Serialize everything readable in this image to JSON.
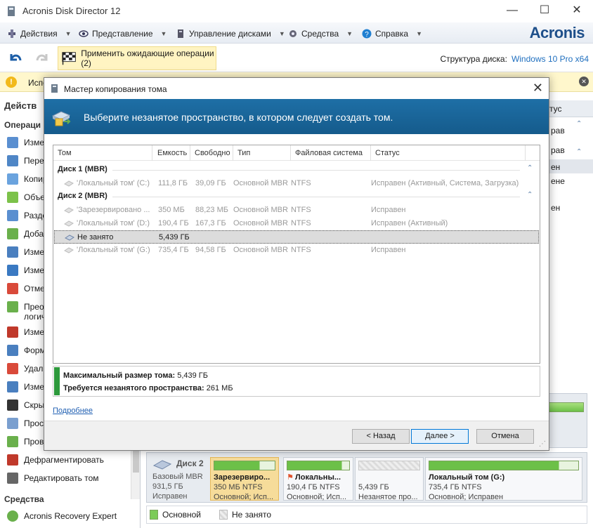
{
  "window": {
    "title": "Acronis Disk Director 12",
    "minimize": "—",
    "maximize": "☐",
    "close": "✕"
  },
  "menu": {
    "items": [
      {
        "label": "Действия"
      },
      {
        "label": "Представление"
      },
      {
        "label": "Управление дисками"
      },
      {
        "label": "Средства"
      },
      {
        "label": "Справка"
      }
    ],
    "brand": "Acronis"
  },
  "toolbar": {
    "apply_label": "Применить ожидающие операции (2)",
    "disk_structure_label": "Структура диска:",
    "disk_structure_value": "Windows 10 Pro x64"
  },
  "infobar": {
    "text": "Испо"
  },
  "sidebar": {
    "header": "Действ",
    "operations_header": "Операци",
    "operations": [
      {
        "label": "Измен",
        "color": "#5a8fd0"
      },
      {
        "label": "Перем",
        "color": "#4f86c6"
      },
      {
        "label": "Копир",
        "color": "#6aa3de"
      },
      {
        "label": "Объед",
        "color": "#7cc24a"
      },
      {
        "label": "Разде",
        "color": "#5a8fd0"
      },
      {
        "label": "Добав",
        "color": "#6ab04c"
      },
      {
        "label": "Измен",
        "color": "#4a7fbf"
      },
      {
        "label": "Измен",
        "color": "#3a79c2"
      },
      {
        "label": "Отме",
        "color": "#d94a3a"
      },
      {
        "label": "Преоб",
        "color": "#6ab04c"
      },
      {
        "label": "логич",
        "color": "#ffffff"
      },
      {
        "label": "Измен",
        "color": "#c0392b"
      },
      {
        "label": "Форм",
        "color": "#4a7fbf"
      },
      {
        "label": "Удал",
        "color": "#d94a3a"
      },
      {
        "label": "Измен",
        "color": "#4a7fbf"
      },
      {
        "label": "Скры",
        "color": "#333333"
      },
      {
        "label": "Прос",
        "color": "#7a9fcf"
      },
      {
        "label": "Пров",
        "color": "#6ab04c"
      },
      {
        "label": "Дефрагментировать",
        "color": "#c0392b"
      },
      {
        "label": "Редактировать том",
        "color": "#666666"
      }
    ],
    "tools_header": "Средства",
    "tools": [
      {
        "label": "Acronis Recovery Expert",
        "color": "#6ab04c"
      }
    ]
  },
  "right_panel": {
    "header": "тус",
    "rows": [
      "рав",
      "рав",
      "ен",
      "ене",
      "ен"
    ]
  },
  "diskmap": {
    "disk": {
      "name": "Диск 2",
      "type": "Базовый MBR",
      "size": "931,5 ГБ",
      "status": "Исправен"
    },
    "partitions": [
      {
        "name": "Зарезервиро...",
        "info": "350 МБ NTFS",
        "status": "Основной; Исп...",
        "fill": 0.75,
        "free": false,
        "selected": true
      },
      {
        "name": "Локальны...",
        "info": "190,4 ГБ NTFS",
        "status": "Основной; Исп...",
        "fill": 0.88,
        "free": false,
        "selected": false
      },
      {
        "name": "",
        "info": "5,439 ГБ",
        "status": "Незанятое про...",
        "fill": 0,
        "free": true,
        "selected": false
      },
      {
        "name": "Локальный том (G:)",
        "info": "735,4 ГБ NTFS",
        "status": "Основной; Исправен",
        "fill": 0.87,
        "free": false,
        "selected": false
      }
    ],
    "legend": {
      "primary": "Основной",
      "free": "Не занято"
    }
  },
  "dialog": {
    "title": "Мастер копирования тома",
    "header_text": "Выберите незанятое пространство, в котором следует создать том.",
    "columns": [
      "Том",
      "Емкость",
      "Свободно",
      "Тип",
      "Файловая система",
      "Статус"
    ],
    "groups": [
      {
        "name": "Диск 1 (MBR)",
        "rows": [
          {
            "volume": "'Локальный том' (C:)",
            "capacity": "111,8 ГБ",
            "free": "39,09 ГБ",
            "type": "Основной MBR",
            "fs": "NTFS",
            "status": "Исправен (Активный, Система, Загрузка)",
            "selected": false
          }
        ]
      },
      {
        "name": "Диск 2 (MBR)",
        "rows": [
          {
            "volume": "'Зарезервировано ...",
            "capacity": "350 МБ",
            "free": "88,23 МБ",
            "type": "Основной MBR",
            "fs": "NTFS",
            "status": "Исправен",
            "selected": false
          },
          {
            "volume": "'Локальный том' (D:)",
            "capacity": "190,4 ГБ",
            "free": "167,3 ГБ",
            "type": "Основной MBR",
            "fs": "NTFS",
            "status": "Исправен (Активный)",
            "selected": false
          },
          {
            "volume": "Не занято",
            "capacity": "5,439 ГБ",
            "free": "",
            "type": "",
            "fs": "",
            "status": "",
            "selected": true
          },
          {
            "volume": "'Локальный том' (G:)",
            "capacity": "735,4 ГБ",
            "free": "94,58 ГБ",
            "type": "Основной MBR",
            "fs": "NTFS",
            "status": "Исправен",
            "selected": false
          }
        ]
      }
    ],
    "summary": {
      "max_size_label": "Максимальный размер тома:",
      "max_size_value": "5,439 ГБ",
      "required_label": "Требуется незанятого пространства:",
      "required_value": "261 МБ"
    },
    "more_link": "Подробнее",
    "buttons": {
      "back": "< Назад",
      "next": "Далее >",
      "cancel": "Отмена"
    }
  }
}
